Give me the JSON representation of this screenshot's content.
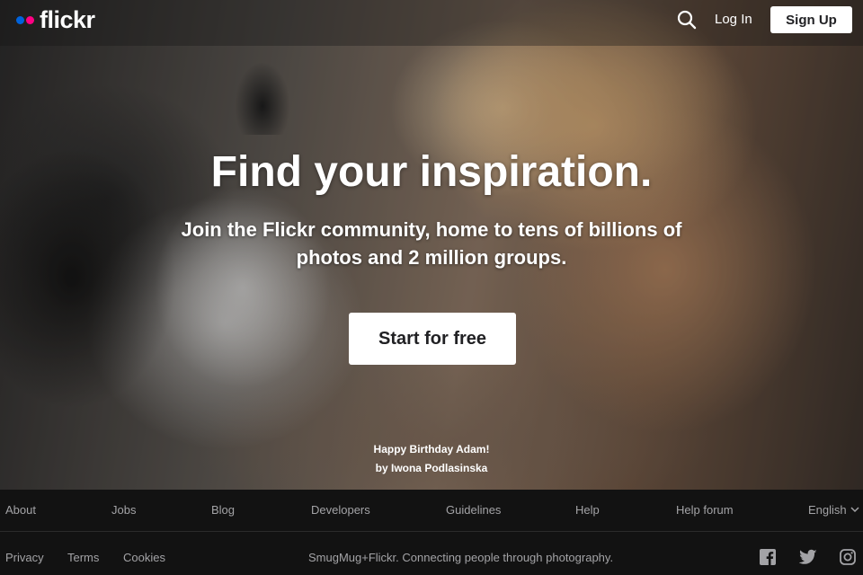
{
  "header": {
    "logo_text": "flickr",
    "login_label": "Log In",
    "signup_label": "Sign Up"
  },
  "hero": {
    "headline": "Find your inspiration.",
    "subline": "Join the Flickr community, home to tens of billions of photos and 2 million groups.",
    "cta_label": "Start for free",
    "photo_title": "Happy Birthday Adam!",
    "photo_author": "by Iwona Podlasinska"
  },
  "footer": {
    "nav": [
      "About",
      "Jobs",
      "Blog",
      "Developers",
      "Guidelines",
      "Help",
      "Help forum"
    ],
    "language": "English",
    "legal": [
      "Privacy",
      "Terms",
      "Cookies"
    ],
    "tagline": "SmugMug+Flickr. Connecting people through photography.",
    "social_icons": [
      "facebook-icon",
      "twitter-icon",
      "instagram-icon"
    ]
  },
  "colors": {
    "logo_blue": "#0063dc",
    "logo_pink": "#ff0084",
    "footer_bg": "#121212",
    "footer_text": "#a3a3a6",
    "button_text": "#212124"
  }
}
